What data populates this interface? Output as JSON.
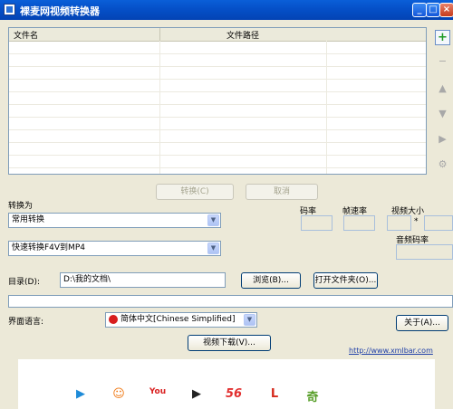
{
  "window": {
    "title": "裸麦网视频转换器",
    "controls": [
      "_",
      "□",
      "×"
    ]
  },
  "file_list": {
    "columns": [
      "文件名",
      "文件路径"
    ],
    "rows": []
  },
  "side_toolbar": [
    {
      "name": "add",
      "glyph": "+"
    },
    {
      "name": "remove",
      "glyph": "−"
    },
    {
      "name": "move-up",
      "glyph": "▲"
    },
    {
      "name": "move-down",
      "glyph": "▼"
    },
    {
      "name": "play",
      "glyph": "▶"
    },
    {
      "name": "properties",
      "glyph": "⚙"
    }
  ],
  "actions": {
    "convert": "转换(C)",
    "cancel": "取消"
  },
  "convert_to": {
    "label": "转换为",
    "category": "常用转换",
    "preset": "快速转换F4V到MP4"
  },
  "params": {
    "bitrate_label": "码率",
    "framerate_label": "帧速率",
    "video_size_label": "视频大小",
    "size_separator": "*",
    "audio_bitrate_label": "音频码率"
  },
  "directory": {
    "label": "目录(D):",
    "value": "D:\\我的文档\\",
    "browse_button": "浏览(B)...",
    "open_folder_button": "打开文件夹(O)..."
  },
  "progress": {
    "value": 0
  },
  "language": {
    "label": "界面语言:",
    "selected": "简体中文[Chinese Simplified]"
  },
  "about_button": "关于(A)...",
  "video_download_button": "视频下载(V)...",
  "site_link": "http://www.xmlbar.com",
  "ad_icons": [
    {
      "name": "player",
      "glyph": "▶",
      "color": "#1e8bd8"
    },
    {
      "name": "smile",
      "glyph": "☺",
      "color": "#f07a16"
    },
    {
      "name": "youtube",
      "glyph": "You",
      "color": "#d92020"
    },
    {
      "name": "tudou",
      "glyph": "▶",
      "color": "#222222"
    },
    {
      "name": "56",
      "glyph": "56",
      "color": "#e23030"
    },
    {
      "name": "letv",
      "glyph": "L",
      "color": "#d62a1d"
    },
    {
      "name": "qiyi",
      "glyph": "奇",
      "color": "#5aa02c"
    }
  ]
}
